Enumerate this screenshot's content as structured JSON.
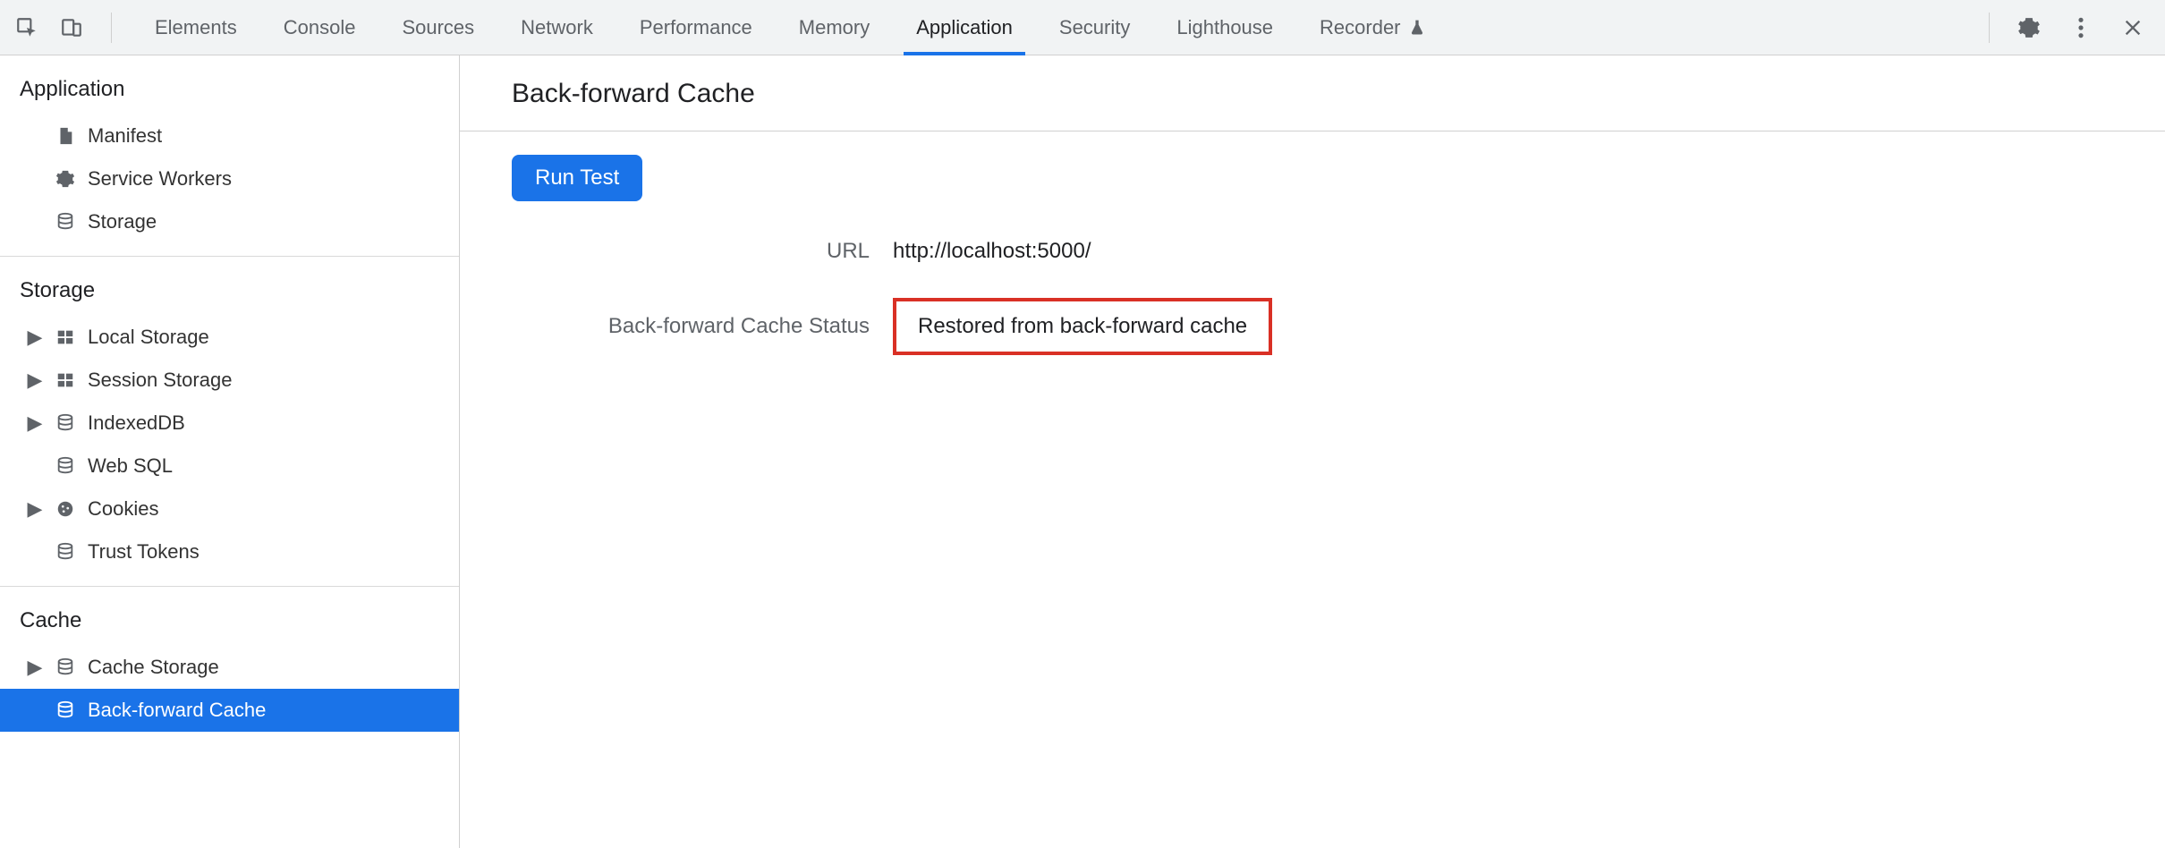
{
  "toolbar": {
    "tabs": [
      {
        "label": "Elements",
        "active": false
      },
      {
        "label": "Console",
        "active": false
      },
      {
        "label": "Sources",
        "active": false
      },
      {
        "label": "Network",
        "active": false
      },
      {
        "label": "Performance",
        "active": false
      },
      {
        "label": "Memory",
        "active": false
      },
      {
        "label": "Application",
        "active": true
      },
      {
        "label": "Security",
        "active": false
      },
      {
        "label": "Lighthouse",
        "active": false
      },
      {
        "label": "Recorder",
        "active": false
      }
    ]
  },
  "sidebar": {
    "sections": [
      {
        "title": "Application",
        "items": [
          {
            "label": "Manifest",
            "icon": "file",
            "disclosure": false,
            "selected": false
          },
          {
            "label": "Service Workers",
            "icon": "gear",
            "disclosure": false,
            "selected": false
          },
          {
            "label": "Storage",
            "icon": "db",
            "disclosure": false,
            "selected": false
          }
        ]
      },
      {
        "title": "Storage",
        "items": [
          {
            "label": "Local Storage",
            "icon": "grid",
            "disclosure": true,
            "selected": false
          },
          {
            "label": "Session Storage",
            "icon": "grid",
            "disclosure": true,
            "selected": false
          },
          {
            "label": "IndexedDB",
            "icon": "db",
            "disclosure": true,
            "selected": false
          },
          {
            "label": "Web SQL",
            "icon": "db",
            "disclosure": false,
            "selected": false
          },
          {
            "label": "Cookies",
            "icon": "cookie",
            "disclosure": true,
            "selected": false
          },
          {
            "label": "Trust Tokens",
            "icon": "db",
            "disclosure": false,
            "selected": false
          }
        ]
      },
      {
        "title": "Cache",
        "items": [
          {
            "label": "Cache Storage",
            "icon": "db",
            "disclosure": true,
            "selected": false
          },
          {
            "label": "Back-forward Cache",
            "icon": "db",
            "disclosure": false,
            "selected": true
          }
        ]
      }
    ]
  },
  "main": {
    "title": "Back-forward Cache",
    "run_button": "Run Test",
    "rows": [
      {
        "label": "URL",
        "value": "http://localhost:5000/",
        "highlight": false
      },
      {
        "label": "Back-forward Cache Status",
        "value": "Restored from back-forward cache",
        "highlight": true
      }
    ]
  }
}
